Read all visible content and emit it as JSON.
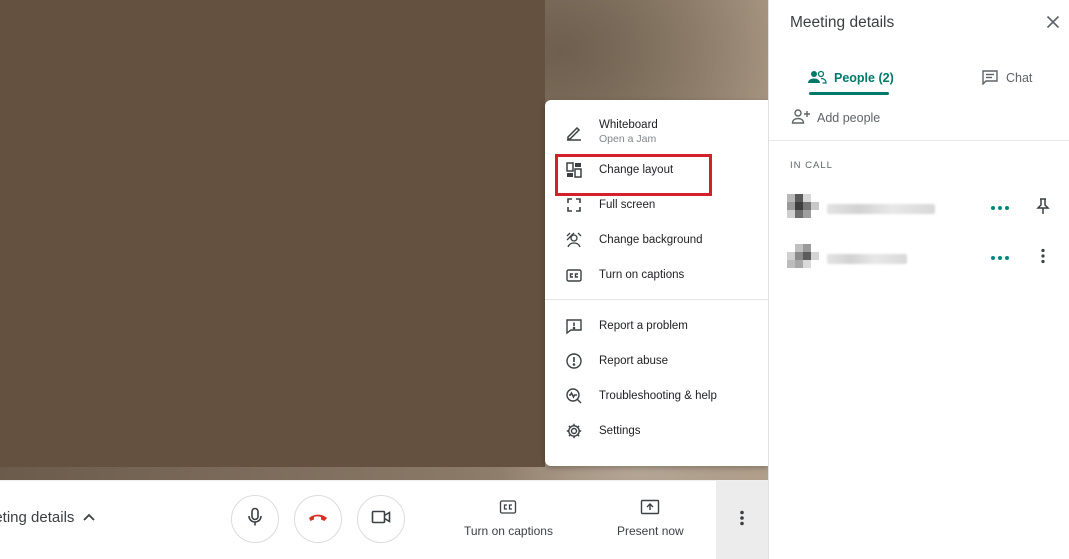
{
  "menu": {
    "items": [
      {
        "label": "Whiteboard",
        "sub": "Open a Jam",
        "icon": "pen-icon"
      },
      {
        "label": "Change layout",
        "icon": "layout-icon"
      },
      {
        "label": "Full screen",
        "icon": "fullscreen-icon"
      },
      {
        "label": "Change background",
        "icon": "background-icon"
      },
      {
        "label": "Turn on captions",
        "icon": "captions-icon"
      },
      {
        "label": "Report a problem",
        "icon": "report-problem-icon"
      },
      {
        "label": "Report abuse",
        "icon": "report-abuse-icon"
      },
      {
        "label": "Troubleshooting & help",
        "icon": "troubleshoot-icon"
      },
      {
        "label": "Settings",
        "icon": "settings-icon"
      }
    ]
  },
  "toolbar": {
    "meeting_details_label": "eeting details",
    "captions_label": "Turn on captions",
    "present_label": "Present now"
  },
  "panel": {
    "title": "Meeting details",
    "tabs": [
      {
        "label": "People (2)"
      },
      {
        "label": "Chat"
      }
    ],
    "add_people_label": "Add people",
    "in_call_label": "IN CALL"
  },
  "colors": {
    "accent": "#00796b",
    "hangup": "#d93025",
    "highlight": "#d3202a",
    "video_tile": "#64513f"
  }
}
